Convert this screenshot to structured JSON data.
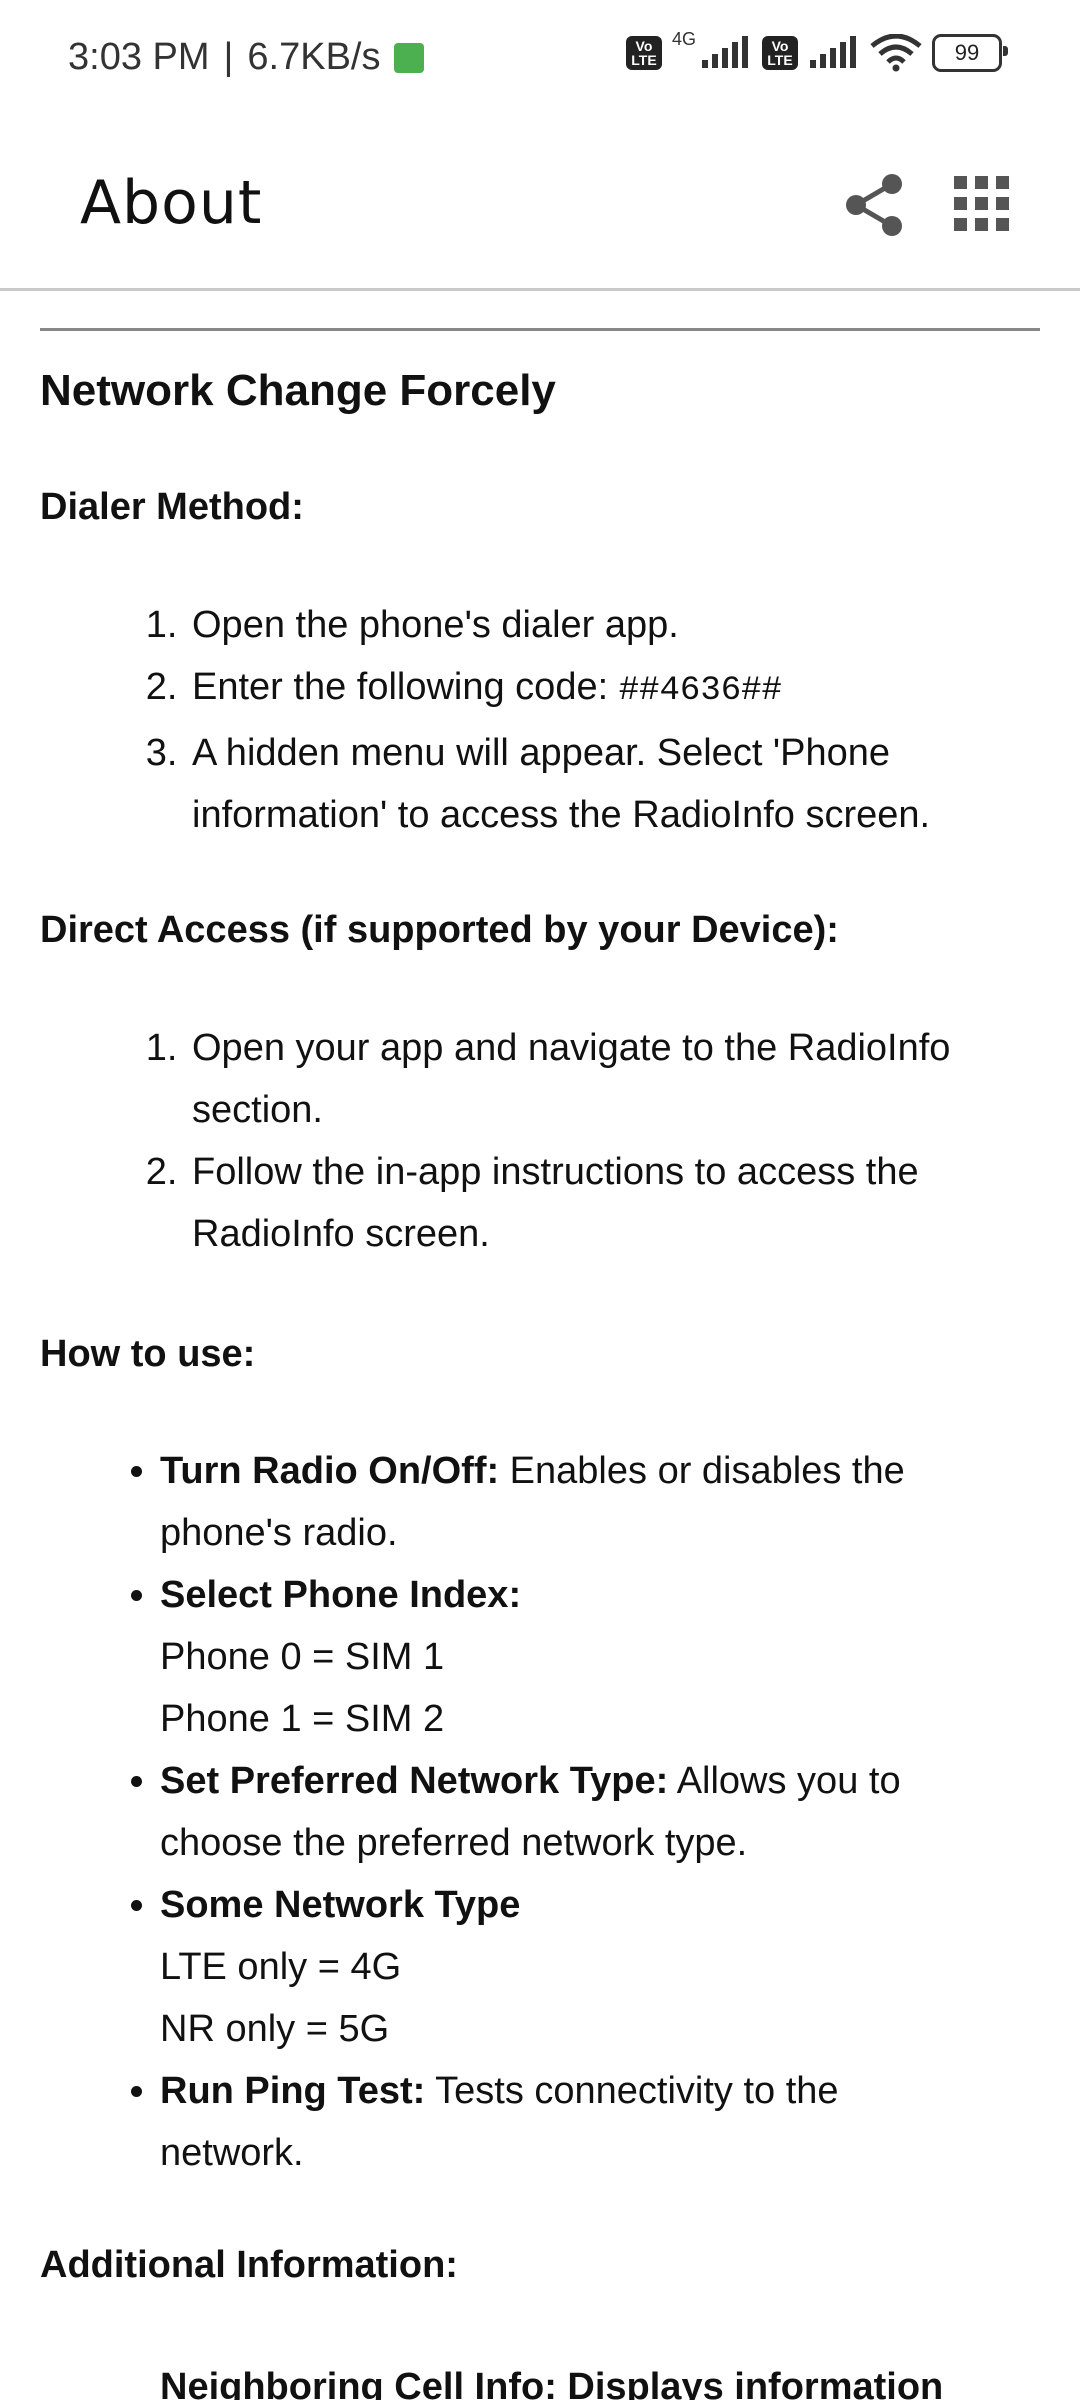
{
  "status_bar": {
    "time": "3:03 PM",
    "separator": "|",
    "speed": "6.7KB/s",
    "volte": "Vo LTE",
    "network": "4G",
    "battery": "99"
  },
  "header": {
    "title": "About",
    "share_icon": "share-icon",
    "menu_icon": "apps-grid-icon"
  },
  "content": {
    "title": "Network Change Forcely",
    "dialer": {
      "heading": "Dialer Method:",
      "steps": [
        {
          "text": "Open the phone's dialer app."
        },
        {
          "text": "Enter the following code: ",
          "code": "##4636##"
        },
        {
          "line1": "A hidden menu will appear. Select 'Phone",
          "line2": "information' to access the RadioInfo screen."
        }
      ]
    },
    "direct": {
      "heading": "Direct Access (if supported by your Device):",
      "steps": [
        {
          "line1": "Open your app and navigate to the RadioInfo",
          "line2": "section."
        },
        {
          "line1": "Follow the in-app instructions to access the",
          "line2": "RadioInfo screen."
        }
      ]
    },
    "howto": {
      "heading": "How to use:",
      "items": [
        {
          "bold": "Turn Radio On/Off:",
          "rest": " Enables or disables the",
          "line2": "phone's radio."
        },
        {
          "bold": "Select Phone Index:",
          "line2": "Phone 0 = SIM 1",
          "line3": "Phone 1 = SIM 2"
        },
        {
          "bold": "Set Preferred Network Type:",
          "rest": " Allows you to",
          "line2": "choose the preferred network type."
        },
        {
          "bold": "Some Network Type",
          "line2": "LTE only = 4G",
          "line3": "NR only = 5G"
        },
        {
          "bold": "Run Ping Test:",
          "rest": " Tests connectivity to the",
          "line2": "network."
        }
      ]
    },
    "additional": {
      "heading": "Additional Information:",
      "cut_item": "Neighboring Cell Info: Displays information"
    }
  }
}
